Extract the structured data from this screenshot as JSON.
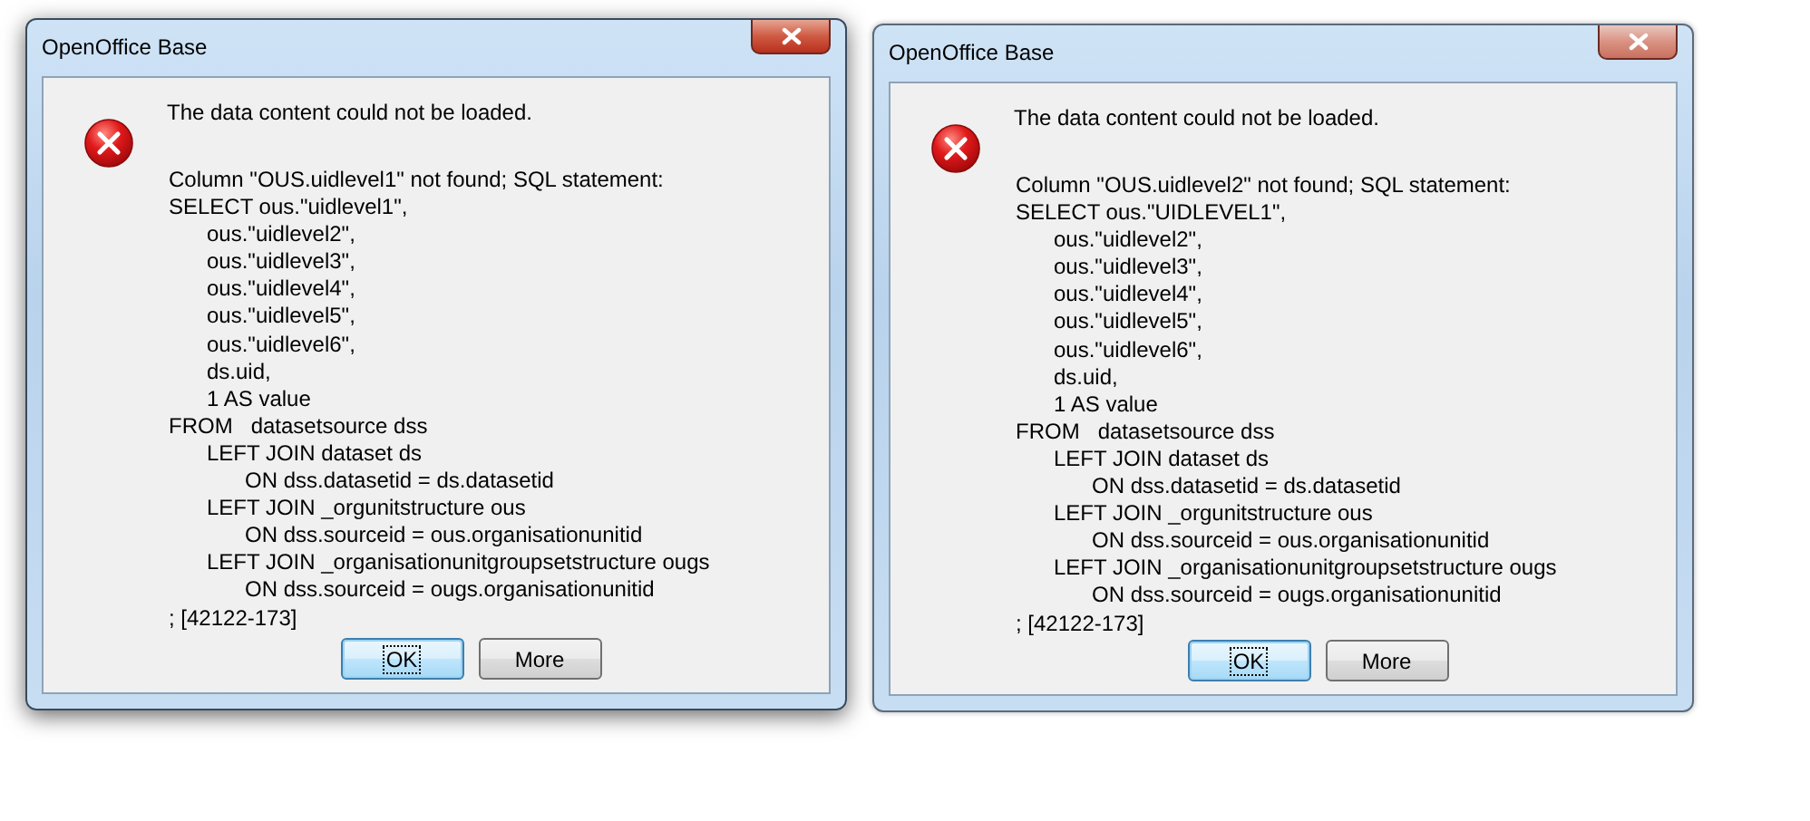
{
  "dialogs": [
    {
      "title": "OpenOffice Base",
      "active": true,
      "message": "The data content could not be loaded.",
      "details": [
        {
          "text": "Column \"OUS.uidlevel1\" not found; SQL statement:"
        },
        {
          "text": "SELECT ous.\"uidlevel1\",",
          "children": [
            {
              "text": "ous.\"uidlevel2\","
            },
            {
              "text": "ous.\"uidlevel3\","
            },
            {
              "text": "ous.\"uidlevel4\","
            },
            {
              "text": "ous.\"uidlevel5\","
            },
            {
              "text": "ous.\"uidlevel6\","
            },
            {
              "text": "ds.uid,"
            },
            {
              "text": "1 AS value"
            }
          ]
        },
        {
          "text": "FROM   datasetsource dss",
          "children": [
            {
              "text": "LEFT JOIN dataset ds",
              "children": [
                {
                  "text": "ON dss.datasetid = ds.datasetid"
                }
              ]
            },
            {
              "text": "LEFT JOIN _orgunitstructure ous",
              "children": [
                {
                  "text": "ON dss.sourceid = ous.organisationunitid"
                }
              ]
            },
            {
              "text": "LEFT JOIN _organisationunitgroupsetstructure ougs",
              "children": [
                {
                  "text": "ON dss.sourceid = ougs.organisationunitid"
                }
              ]
            }
          ]
        },
        {
          "text": "; [42122-173]"
        }
      ],
      "buttons": [
        {
          "label": "OK",
          "default": true
        },
        {
          "label": "More",
          "default": false
        }
      ]
    },
    {
      "title": "OpenOffice Base",
      "active": false,
      "message": "The data content could not be loaded.",
      "details": [
        {
          "text": "Column \"OUS.uidlevel2\" not found; SQL statement:"
        },
        {
          "text": "SELECT ous.\"UIDLEVEL1\",",
          "children": [
            {
              "text": "ous.\"uidlevel2\","
            },
            {
              "text": "ous.\"uidlevel3\","
            },
            {
              "text": "ous.\"uidlevel4\","
            },
            {
              "text": "ous.\"uidlevel5\","
            },
            {
              "text": "ous.\"uidlevel6\","
            },
            {
              "text": "ds.uid,"
            },
            {
              "text": "1 AS value"
            }
          ]
        },
        {
          "text": "FROM   datasetsource dss",
          "children": [
            {
              "text": "LEFT JOIN dataset ds",
              "children": [
                {
                  "text": "ON dss.datasetid = ds.datasetid"
                }
              ]
            },
            {
              "text": "LEFT JOIN _orgunitstructure ous",
              "children": [
                {
                  "text": "ON dss.sourceid = ous.organisationunitid"
                }
              ]
            },
            {
              "text": "LEFT JOIN _organisationunitgroupsetstructure ougs",
              "children": [
                {
                  "text": "ON dss.sourceid = ougs.organisationunitid"
                }
              ]
            }
          ]
        },
        {
          "text": "; [42122-173]"
        }
      ],
      "buttons": [
        {
          "label": "OK",
          "default": true
        },
        {
          "label": "More",
          "default": false
        }
      ]
    }
  ]
}
